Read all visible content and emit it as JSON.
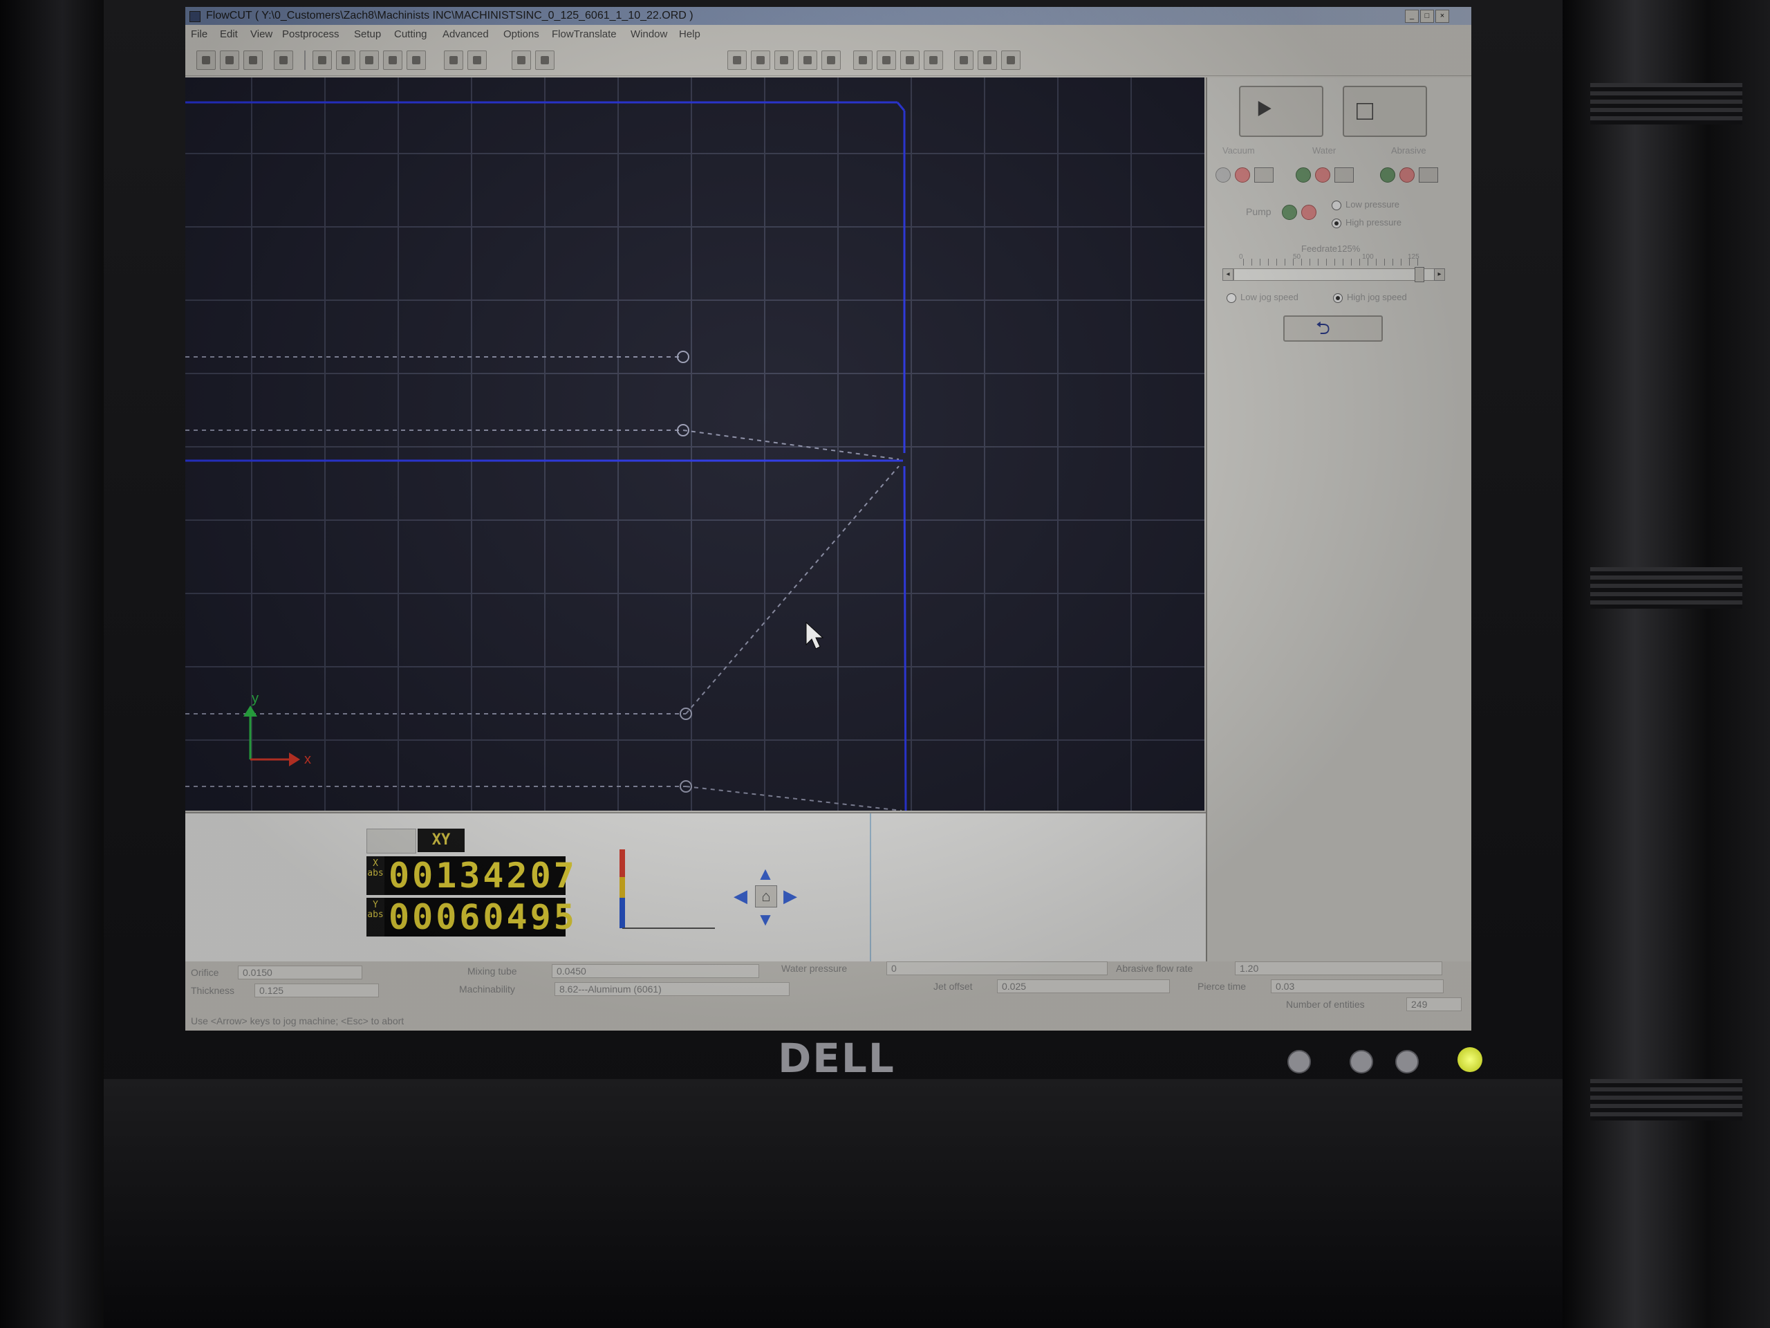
{
  "window": {
    "title": "FlowCUT ( Y:\\0_Customers\\Zach8\\Machinists INC\\MACHINISTSINC_0_125_6061_1_10_22.ORD )"
  },
  "menu": [
    "File",
    "Edit",
    "View",
    "Postprocess",
    "Setup",
    "Cutting",
    "Advanced",
    "Options",
    "FlowTranslate",
    "Window",
    "Help"
  ],
  "canvas": {
    "axis_x_label": "x",
    "axis_y_label": "y",
    "path_color": "#1f3cff",
    "background": "#1b1c2a"
  },
  "control_panel": {
    "groups": [
      "Vacuum",
      "Water",
      "Abrasive"
    ],
    "pump_label": "Pump",
    "low_pressure": "Low pressure",
    "high_pressure": "High pressure",
    "pressure_selected": "High pressure",
    "feedrate_label": "Feedrate125%",
    "feedrate_ticks": [
      "0",
      "50",
      "100",
      "125"
    ],
    "feedrate_percent": 125,
    "low_jog": "Low jog speed",
    "high_jog": "High jog speed",
    "jog_selected": "High jog speed",
    "back_icon": "undo-arrow-icon"
  },
  "readout": {
    "mode_tab": "XY",
    "x_axis_tag": "X abs",
    "y_axis_tag": "Y abs",
    "x_value": "00134207",
    "y_value": "00060495"
  },
  "status": {
    "orifice_label": "Orifice",
    "orifice_value": "0.0150",
    "thickness_label": "Thickness",
    "thickness_value": "0.125",
    "mixing_tube_label": "Mixing tube",
    "mixing_tube_value": "0.0450",
    "machinability_label": "Machinability",
    "machinability_value": "8.62---Aluminum (6061)",
    "water_pressure_label": "Water pressure",
    "water_pressure_value": "0",
    "jet_offset_label": "Jet offset",
    "jet_offset_value": "0.025",
    "abrasive_flow_label": "Abrasive flow rate",
    "abrasive_flow_value": "1.20",
    "pierce_time_label": "Pierce time",
    "pierce_time_value": "0.03",
    "entities_label": "Number of entities",
    "entities_value": "249",
    "hint": "Use <Arrow> keys to jog machine; <Esc> to abort"
  },
  "monitor": {
    "brand": "DELL"
  }
}
